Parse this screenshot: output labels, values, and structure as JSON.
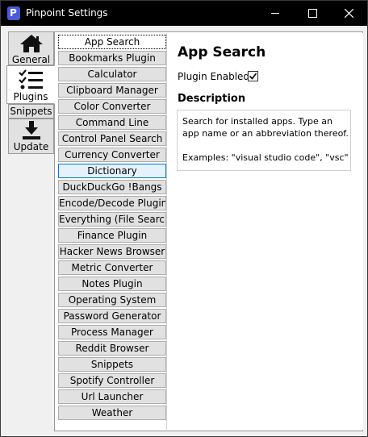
{
  "window": {
    "title": "Pinpoint Settings",
    "app_icon_letter": "P",
    "controls": [
      "minimize",
      "maximize",
      "close"
    ]
  },
  "nav": {
    "tabs": [
      {
        "label": "General",
        "icon": "home-icon",
        "active": false
      },
      {
        "label": "Plugins",
        "icon": "checklist-icon",
        "active": true
      },
      {
        "label": "Snippets",
        "icon": "",
        "active": false
      },
      {
        "label": "Update",
        "icon": "download-icon",
        "active": false
      }
    ]
  },
  "plugins": {
    "items": [
      "App Search",
      "Bookmarks Plugin",
      "Calculator",
      "Clipboard Manager",
      "Color Converter",
      "Command Line",
      "Control Panel Search",
      "Currency Converter",
      "Dictionary",
      "DuckDuckGo !Bangs",
      "Encode/Decode Plugin",
      "Everything (File Search)",
      "Finance Plugin",
      "Hacker News Browser",
      "Metric Converter",
      "Notes Plugin",
      "Operating System",
      "Password Generator",
      "Process Manager",
      "Reddit Browser",
      "Snippets",
      "Spotify Controller",
      "Url Launcher",
      "Weather"
    ],
    "selected": "App Search",
    "hovered": "Dictionary"
  },
  "detail": {
    "title": "App Search",
    "enabled_label": "Plugin Enabled:",
    "enabled": true,
    "description_heading": "Description",
    "description_lines": [
      "Search for installed apps. Type an",
      "app name or an abbreviation thereof.",
      "",
      "Examples: \"visual studio code\", \"vsc\""
    ]
  },
  "colors": {
    "titlebar": "#000000",
    "accent": "#4a5bd8",
    "hover_border": "#0078d7"
  }
}
